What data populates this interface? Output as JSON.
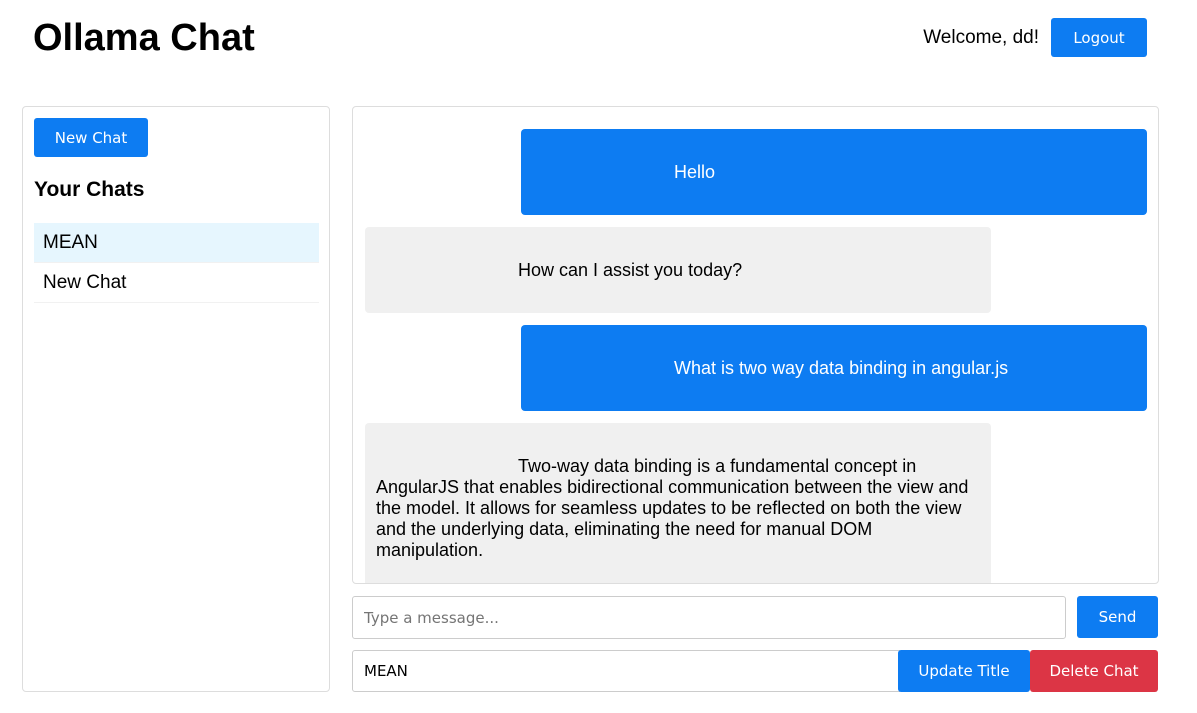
{
  "header": {
    "title": "Ollama Chat",
    "welcome": "Welcome, dd!",
    "logout_label": "Logout"
  },
  "sidebar": {
    "new_chat_label": "New Chat",
    "heading": "Your Chats",
    "chats": [
      {
        "label": "MEAN",
        "active": true
      },
      {
        "label": "New Chat",
        "active": false
      }
    ]
  },
  "messages": [
    {
      "role": "user",
      "text": "Hello"
    },
    {
      "role": "assistant",
      "text": "How can I assist you today?"
    },
    {
      "role": "user",
      "text": "What is two way data binding in angular.js"
    },
    {
      "role": "assistant",
      "text": "Two-way data binding is a fundamental concept in AngularJS that enables bidirectional communication between the view and the model. It allows for seamless updates to be reflected on both the view and the underlying data, eliminating the need for manual DOM manipulation."
    }
  ],
  "composer": {
    "placeholder": "Type a message...",
    "value": "",
    "send_label": "Send"
  },
  "title_editor": {
    "value": "MEAN",
    "update_label": "Update Title",
    "delete_label": "Delete Chat"
  },
  "colors": {
    "primary": "#0d7cf2",
    "danger": "#dc3545",
    "bot_bubble": "#f0f0f0",
    "active_chat": "#e6f6fe"
  }
}
